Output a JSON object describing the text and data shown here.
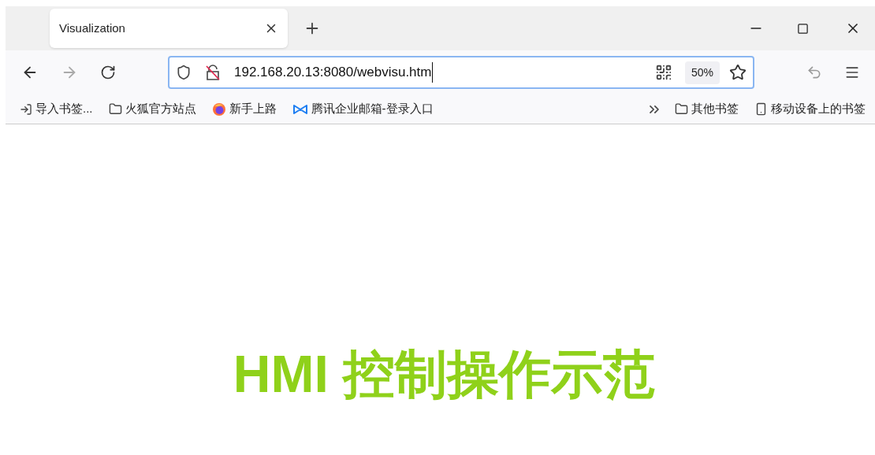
{
  "tabs": [
    {
      "title": "Visualization",
      "selected": true
    }
  ],
  "address_bar": {
    "value": "192.168.20.13:8080/webvisu.htm",
    "zoom": "50%"
  },
  "bookmarks": [
    {
      "kind": "import",
      "label": "导入书签..."
    },
    {
      "kind": "folder",
      "label": "火狐官方站点"
    },
    {
      "kind": "firefox",
      "label": "新手上路"
    },
    {
      "kind": "tencent",
      "label": "腾讯企业邮箱-登录入口"
    }
  ],
  "bookmarks_right": [
    {
      "kind": "folder",
      "label": "其他书签"
    },
    {
      "kind": "mobile",
      "label": "移动设备上的书签"
    }
  ],
  "page": {
    "heading": "HMI 控制操作示范"
  }
}
